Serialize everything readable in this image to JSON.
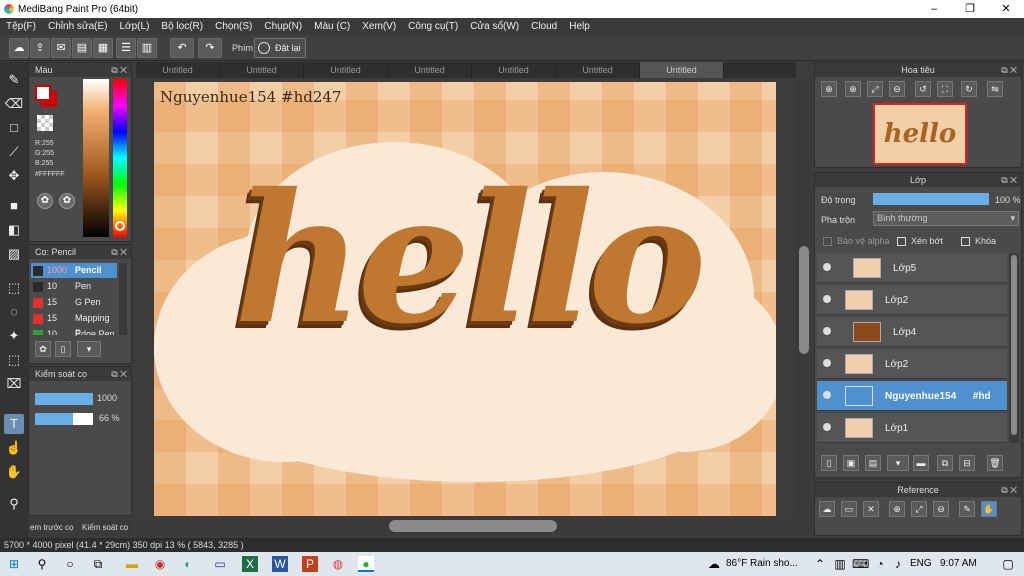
{
  "window": {
    "title": "MediBang Paint Pro (64bit)",
    "minimize": "–",
    "maximize": "❐",
    "close": "✕"
  },
  "menu": [
    "Tệp(F)",
    "Chỉnh sửa(E)",
    "Lớp(L)",
    "Bộ lọc(R)",
    "Chọn(S)",
    "Chụp(N)",
    "Màu (C)",
    "Xem(V)",
    "Công cụ(T)",
    "Cửa sổ(W)",
    "Cloud",
    "Help"
  ],
  "toolbar": {
    "shortcut_label": "Phím",
    "reset_label": "Đặt lại"
  },
  "color_panel": {
    "title": "Màu",
    "r": "R:255",
    "g": "G:255",
    "b": "B:255",
    "hex": "#FFFFFF",
    "primary": "#ffffff",
    "secondary": "#cc0000"
  },
  "brush_panel": {
    "title": "Cọ: Pencil",
    "items": [
      {
        "size": "1000",
        "name": "Pencil",
        "color": "#2a2a2a"
      },
      {
        "size": "10",
        "name": "Pen",
        "color": "#2a2a2a"
      },
      {
        "size": "15",
        "name": "G Pen",
        "color": "#e03030"
      },
      {
        "size": "15",
        "name": "Mapping P",
        "color": "#e03030"
      },
      {
        "size": "10",
        "name": "Edge Pen",
        "color": "#30a030"
      }
    ]
  },
  "brush_control": {
    "title": "Kiểm soát cọ",
    "size": "1000",
    "opacity": "66 %",
    "size_fill": 1.0,
    "opacity_fill": 0.66
  },
  "left_tabs": {
    "tab1": "em trước cọ",
    "tab2": "Kiểm soát cọ"
  },
  "doc_tabs": [
    "Untitled",
    "Untitled",
    "Untitled",
    "Untitled",
    "Untitled",
    "Untitled",
    "Untitled"
  ],
  "canvas": {
    "watermark": "Nguyenhue154    #hd247",
    "art_text": "hello"
  },
  "navigator": {
    "title": "Hoa tiêu",
    "thumb_text": "hello"
  },
  "layer_panel": {
    "title": "Lớp",
    "opacity_label": "Độ trong",
    "opacity_value": "100 %",
    "opacity_fill": 1.0,
    "blend_label": "Pha trộn",
    "blend_value": "Bình thường",
    "protect_alpha": "Bảo vệ alpha",
    "clipping": "Xén bớt",
    "lock": "Khóa",
    "layers": [
      {
        "name": "Lớp5",
        "sub": true
      },
      {
        "name": "Lớp2",
        "sub": false
      },
      {
        "name": "Lớp4",
        "sub": true
      },
      {
        "name": "Lớp2",
        "sub": false
      },
      {
        "name": "Nguyenhue154      #hd",
        "sub": false,
        "selected": true
      },
      {
        "name": "Lớp1",
        "sub": false
      }
    ]
  },
  "reference_panel": {
    "title": "Reference"
  },
  "status": {
    "text": "5700 * 4000 pixel  (41.4 * 29cm)  350 dpi  13 %  ( 5843, 3285 )"
  },
  "taskbar": {
    "weather": "86°F  Rain sho...",
    "lang": "ENG",
    "time": "9:07 AM"
  }
}
